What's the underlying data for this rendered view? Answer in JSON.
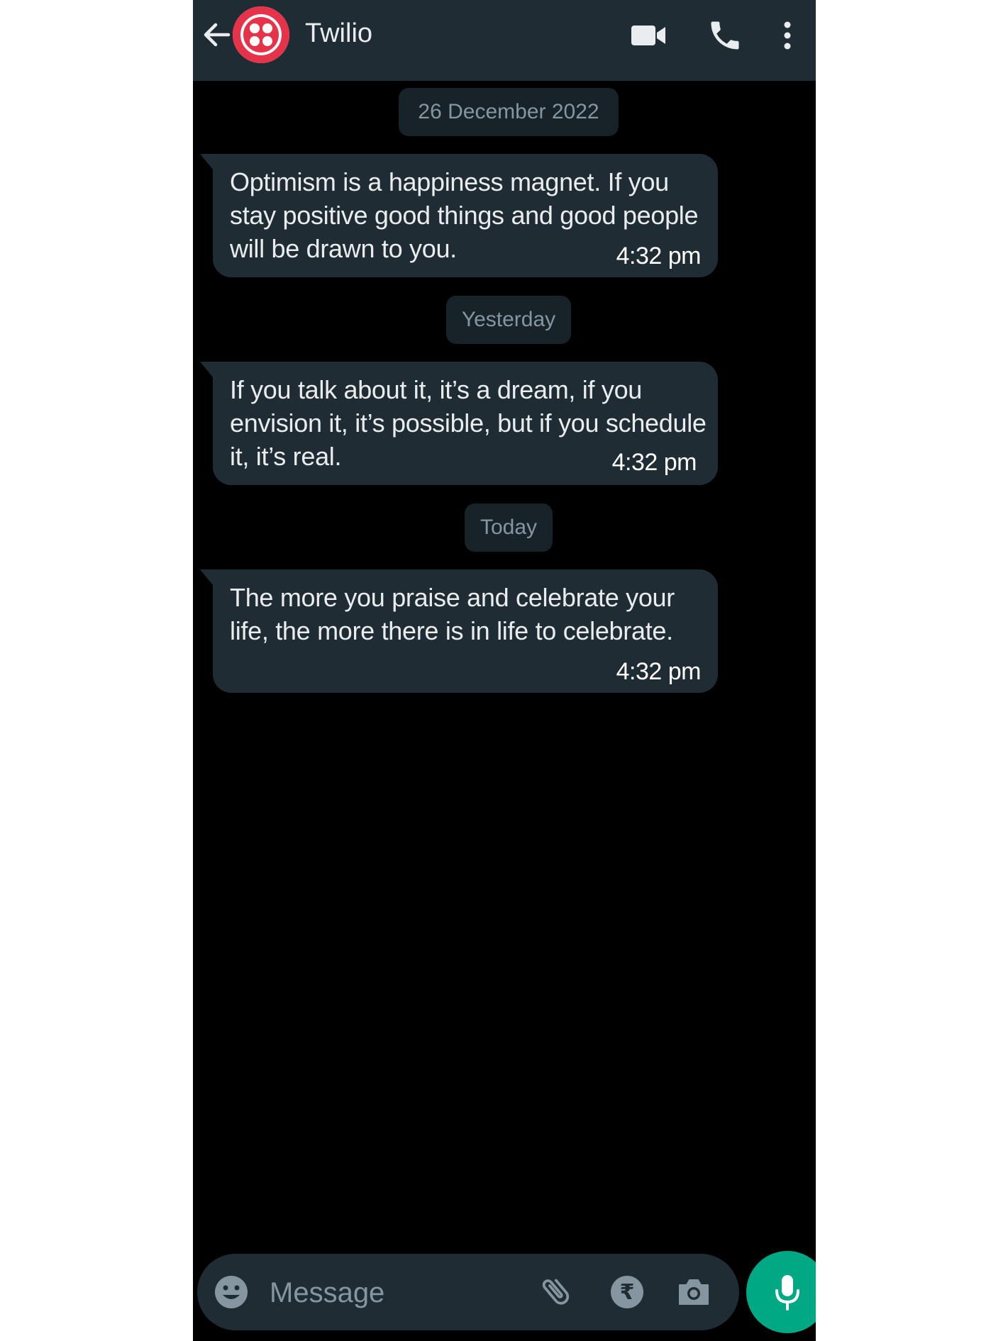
{
  "colors": {
    "header_bg": "#202c33",
    "chat_bg": "#000000",
    "bubble_bg": "#202c33",
    "date_chip_bg": "#182229",
    "accent_green": "#00a884",
    "avatar_red": "#e7334a"
  },
  "header": {
    "contact_name": "Twilio",
    "icons": [
      "back-arrow-icon",
      "twilio-logo",
      "video-call-icon",
      "voice-call-icon",
      "more-options-icon"
    ]
  },
  "chat": {
    "days": [
      {
        "date_label": "26 December 2022",
        "message": {
          "text": "Optimism is a happiness magnet. If you stay positive good things and good people will be drawn to you.",
          "time": "4:32 pm"
        }
      },
      {
        "date_label": "Yesterday",
        "message": {
          "text": "If you talk about it, it’s a dream, if you envision it, it’s possible, but if you schedule it, it’s real.",
          "time": "4:32 pm"
        }
      },
      {
        "date_label": "Today",
        "message": {
          "text": "The more you praise and celebrate your life, the more there is in life to celebrate.",
          "time": "4:32 pm"
        }
      }
    ]
  },
  "input_bar": {
    "placeholder": "Message",
    "icons": [
      "emoji-icon",
      "attach-icon",
      "rupee-payment-icon",
      "camera-icon",
      "mic-icon"
    ]
  }
}
